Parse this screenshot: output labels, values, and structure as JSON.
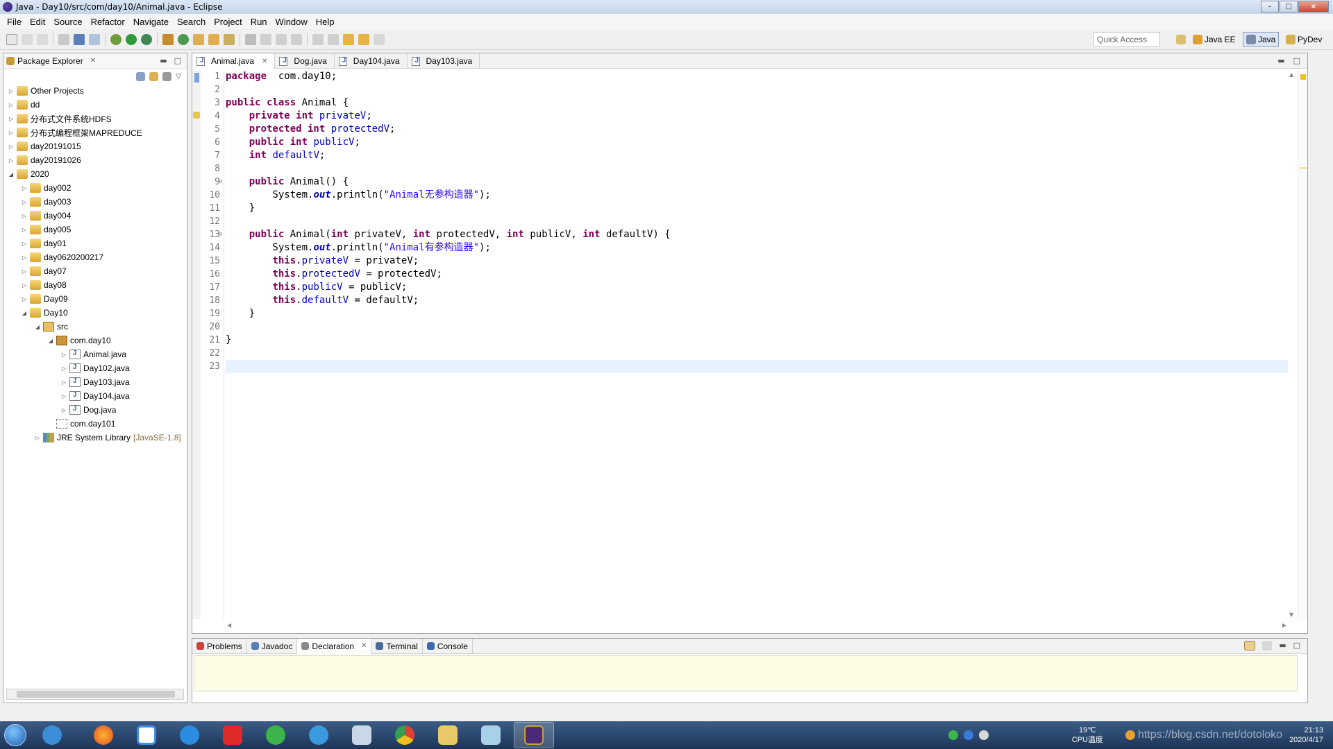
{
  "window": {
    "title": "Java - Day10/src/com/day10/Animal.java - Eclipse",
    "minimize": "–",
    "maximize": "□",
    "close": "×"
  },
  "menu": [
    "File",
    "Edit",
    "Source",
    "Refactor",
    "Navigate",
    "Search",
    "Project",
    "Run",
    "Window",
    "Help"
  ],
  "toolbar": {
    "quick_access": "Quick Access",
    "perspectives": [
      "Java EE",
      "Java",
      "PyDev"
    ]
  },
  "package_explorer": {
    "title": "Package Explorer",
    "items": [
      {
        "label": "Other Projects",
        "level": 0,
        "expanded": false,
        "type": "proj"
      },
      {
        "label": "dd",
        "level": 0,
        "expanded": false,
        "type": "proj"
      },
      {
        "label": "分布式文件系统HDFS",
        "level": 0,
        "expanded": false,
        "type": "proj"
      },
      {
        "label": "分布式编程框架MAPREDUCE",
        "level": 0,
        "expanded": false,
        "type": "proj"
      },
      {
        "label": "day20191015",
        "level": 0,
        "expanded": false,
        "type": "proj"
      },
      {
        "label": "day20191026",
        "level": 0,
        "expanded": false,
        "type": "proj"
      },
      {
        "label": "2020",
        "level": 0,
        "expanded": true,
        "type": "proj"
      },
      {
        "label": "day002",
        "level": 1,
        "expanded": false,
        "type": "proj"
      },
      {
        "label": "day003",
        "level": 1,
        "expanded": false,
        "type": "proj"
      },
      {
        "label": "day004",
        "level": 1,
        "expanded": false,
        "type": "proj"
      },
      {
        "label": "day005",
        "level": 1,
        "expanded": false,
        "type": "proj"
      },
      {
        "label": "day01",
        "level": 1,
        "expanded": false,
        "type": "proj"
      },
      {
        "label": "day0620200217",
        "level": 1,
        "expanded": false,
        "type": "proj"
      },
      {
        "label": "day07",
        "level": 1,
        "expanded": false,
        "type": "proj"
      },
      {
        "label": "day08",
        "level": 1,
        "expanded": false,
        "type": "proj"
      },
      {
        "label": "Day09",
        "level": 1,
        "expanded": false,
        "type": "proj"
      },
      {
        "label": "Day10",
        "level": 1,
        "expanded": true,
        "type": "proj"
      },
      {
        "label": "src",
        "level": 2,
        "expanded": true,
        "type": "src"
      },
      {
        "label": "com.day10",
        "level": 3,
        "expanded": true,
        "type": "pkg"
      },
      {
        "label": "Animal.java",
        "level": 4,
        "expanded": false,
        "type": "java"
      },
      {
        "label": "Day102.java",
        "level": 4,
        "expanded": false,
        "type": "java"
      },
      {
        "label": "Day103.java",
        "level": 4,
        "expanded": false,
        "type": "java"
      },
      {
        "label": "Day104.java",
        "level": 4,
        "expanded": false,
        "type": "java"
      },
      {
        "label": "Dog.java",
        "level": 4,
        "expanded": false,
        "type": "java"
      },
      {
        "label": "com.day101",
        "level": 3,
        "expanded": null,
        "type": "pkgempty"
      },
      {
        "label": "JRE System Library",
        "level": 2,
        "expanded": false,
        "type": "lib",
        "tag": "[JavaSE-1.8]"
      }
    ]
  },
  "editor": {
    "tabs": [
      {
        "label": "Animal.java",
        "active": true
      },
      {
        "label": "Dog.java",
        "active": false
      },
      {
        "label": "Day104.java",
        "active": false
      },
      {
        "label": "Day103.java",
        "active": false
      }
    ],
    "current_line": 23,
    "lines": [
      [
        [
          "kw",
          "package"
        ],
        [
          "",
          "  com.day10;"
        ]
      ],
      [],
      [
        [
          "kw",
          "public class"
        ],
        [
          "",
          " Animal {"
        ]
      ],
      [
        [
          "",
          "    "
        ],
        [
          "kw",
          "private int"
        ],
        [
          "",
          " "
        ],
        [
          "fd",
          "privateV"
        ],
        [
          "",
          ";"
        ]
      ],
      [
        [
          "",
          "    "
        ],
        [
          "kw",
          "protected int"
        ],
        [
          "",
          " "
        ],
        [
          "fd",
          "protectedV"
        ],
        [
          "",
          ";"
        ]
      ],
      [
        [
          "",
          "    "
        ],
        [
          "kw",
          "public int"
        ],
        [
          "",
          " "
        ],
        [
          "fd",
          "publicV"
        ],
        [
          "",
          ";"
        ]
      ],
      [
        [
          "",
          "    "
        ],
        [
          "kw",
          "int"
        ],
        [
          "",
          " "
        ],
        [
          "fd",
          "defaultV"
        ],
        [
          "",
          ";"
        ]
      ],
      [],
      [
        [
          "",
          "    "
        ],
        [
          "kw",
          "public"
        ],
        [
          "",
          " Animal() {"
        ]
      ],
      [
        [
          "",
          "        System."
        ],
        [
          "it",
          "out"
        ],
        [
          "",
          ".println("
        ],
        [
          "st",
          "\"Animal无参构造器\""
        ],
        [
          "",
          ");"
        ]
      ],
      [
        [
          "",
          "    }"
        ]
      ],
      [],
      [
        [
          "",
          "    "
        ],
        [
          "kw",
          "public"
        ],
        [
          "",
          " Animal("
        ],
        [
          "kw",
          "int"
        ],
        [
          "",
          " privateV, "
        ],
        [
          "kw",
          "int"
        ],
        [
          "",
          " protectedV, "
        ],
        [
          "kw",
          "int"
        ],
        [
          "",
          " publicV, "
        ],
        [
          "kw",
          "int"
        ],
        [
          "",
          " defaultV) {"
        ]
      ],
      [
        [
          "",
          "        System."
        ],
        [
          "it",
          "out"
        ],
        [
          "",
          ".println("
        ],
        [
          "st",
          "\"Animal有参构造器\""
        ],
        [
          "",
          ");"
        ]
      ],
      [
        [
          "",
          "        "
        ],
        [
          "kw",
          "this"
        ],
        [
          "",
          "."
        ],
        [
          "fd",
          "privateV"
        ],
        [
          "",
          " = privateV;"
        ]
      ],
      [
        [
          "",
          "        "
        ],
        [
          "kw",
          "this"
        ],
        [
          "",
          "."
        ],
        [
          "fd",
          "protectedV"
        ],
        [
          "",
          " = protectedV;"
        ]
      ],
      [
        [
          "",
          "        "
        ],
        [
          "kw",
          "this"
        ],
        [
          "",
          "."
        ],
        [
          "fd",
          "publicV"
        ],
        [
          "",
          " = publicV;"
        ]
      ],
      [
        [
          "",
          "        "
        ],
        [
          "kw",
          "this"
        ],
        [
          "",
          "."
        ],
        [
          "fd",
          "defaultV"
        ],
        [
          "",
          " = defaultV;"
        ]
      ],
      [
        [
          "",
          "    }"
        ]
      ],
      [],
      [
        [
          "",
          "}"
        ]
      ],
      [],
      []
    ]
  },
  "bottom_panel": {
    "tabs": [
      "Problems",
      "Javadoc",
      "Declaration",
      "Terminal",
      "Console"
    ],
    "active": "Declaration"
  },
  "taskbar": {
    "temp": "19℃",
    "cpu_label": "CPU温度",
    "time": "21:13",
    "date": "2020/4/17",
    "watermark": "https://blog.csdn.net/dotoloko"
  }
}
